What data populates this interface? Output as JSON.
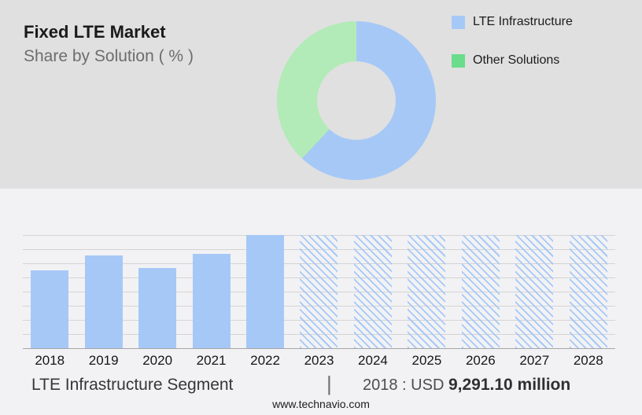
{
  "header": {
    "title": "Fixed LTE Market",
    "subtitle": "Share by Solution ( % )"
  },
  "caption": {
    "segment_label": "LTE Infrastructure Segment",
    "separator": "|",
    "value_prefix": "2018 : USD ",
    "value_amount": "9,291.10 million"
  },
  "footer": {
    "url": "www.technavio.com"
  },
  "colors": {
    "accent_blue": "#a6c8f7",
    "slice_green": "#b2ebb7",
    "legend_green": "#6bdc8c",
    "top_panel_bg": "#e0e0e0",
    "bottom_panel_bg": "#f2f2f4"
  },
  "chart_data": [
    {
      "type": "pie",
      "donut": true,
      "title": "Fixed LTE Market",
      "subtitle": "Share by Solution ( % )",
      "start_angle_deg": 0,
      "direction": "clockwise",
      "legend_position": "right",
      "data_labels_shown": false,
      "slices": [
        {
          "label": "LTE Infrastructure",
          "value": 62,
          "color": "#a6c8f7",
          "legend_color": "#a6c8f7"
        },
        {
          "label": "Other Solutions",
          "value": 38,
          "color": "#b2ebb7",
          "legend_color": "#6bdc8c"
        }
      ]
    },
    {
      "type": "bar",
      "categories": [
        "2018",
        "2019",
        "2020",
        "2021",
        "2022",
        "2023",
        "2024",
        "2025",
        "2026",
        "2027",
        "2028"
      ],
      "values": [
        69,
        82,
        71,
        83,
        100,
        100,
        100,
        100,
        100,
        100,
        100
      ],
      "value_scale": "percent_of_plot_height_estimated",
      "labeled_point": {
        "category": "2018",
        "value": "USD 9,291.10 million"
      },
      "bar_color": "#a6c8f7",
      "forecast_start_index": 5,
      "forecast_style": "diagonal-hatch",
      "grid": true,
      "gridline_count": 9,
      "y_axis_labels_shown": false,
      "xlabel": "",
      "ylabel": ""
    }
  ]
}
